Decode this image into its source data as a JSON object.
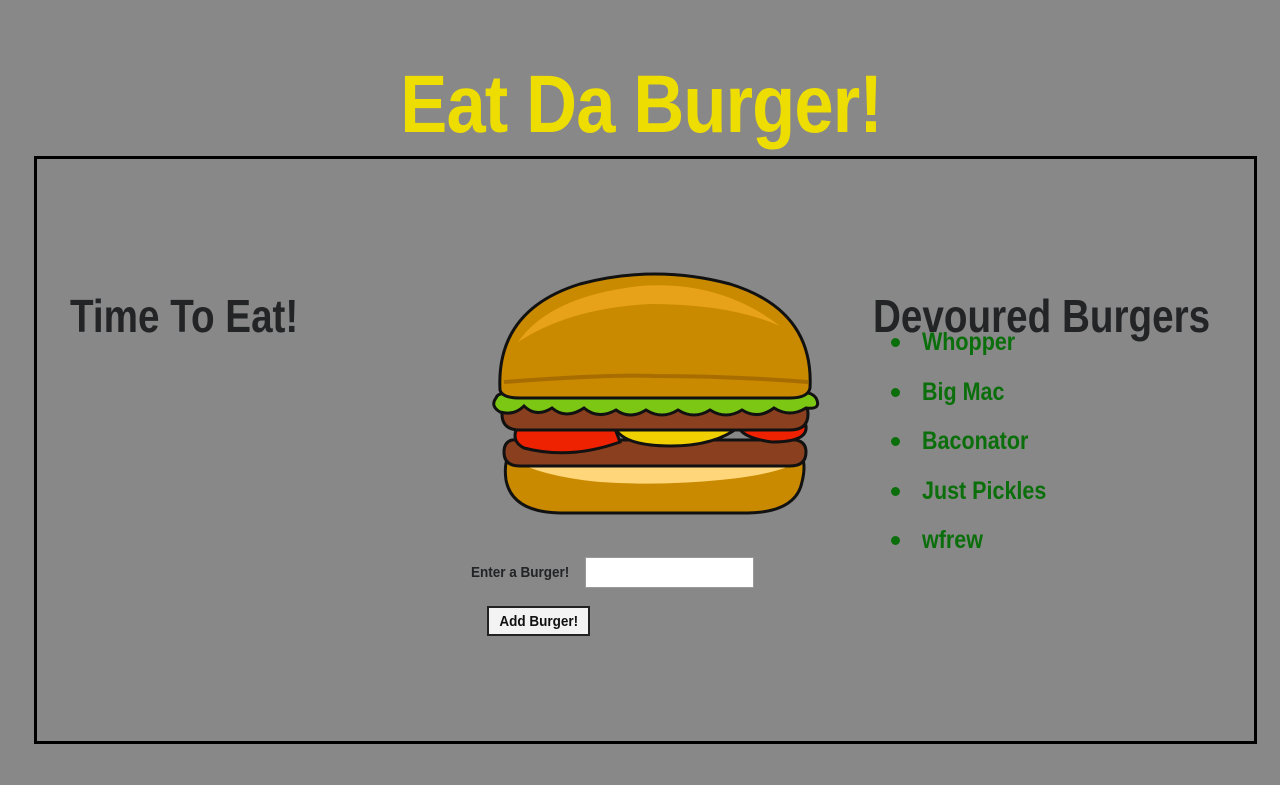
{
  "header": {
    "title": "Eat Da Burger!"
  },
  "left_column": {
    "heading": "Time To Eat!"
  },
  "right_column": {
    "heading": "Devoured Burgers",
    "items": [
      {
        "name": "Whopper"
      },
      {
        "name": "Big Mac"
      },
      {
        "name": "Baconator"
      },
      {
        "name": "Just Pickles"
      },
      {
        "name": "wfrew"
      }
    ]
  },
  "form": {
    "label": "Enter a Burger!",
    "input_value": "",
    "input_placeholder": "",
    "submit_label": "Add Burger!"
  },
  "image": {
    "icon": "burger-illustration"
  },
  "colors": {
    "background": "#888888",
    "title": "#eedd00",
    "list_text": "#0a6e0a",
    "heading": "#222426"
  }
}
